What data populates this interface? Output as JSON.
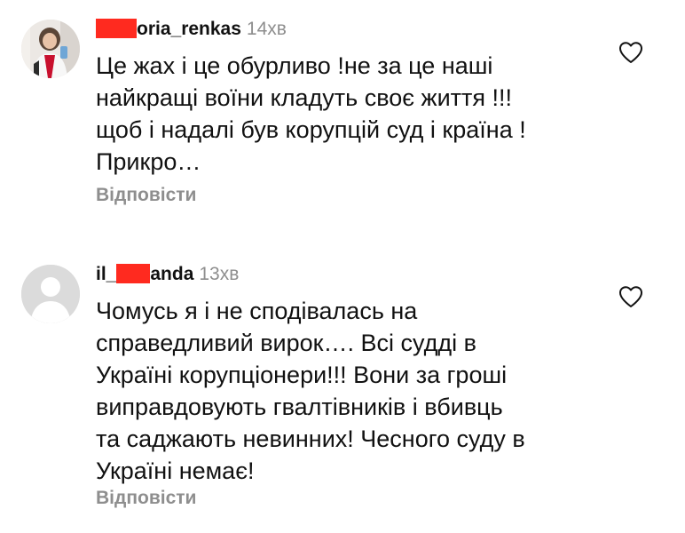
{
  "comments": [
    {
      "username": "oria_renkas",
      "time": "14хв",
      "lines": [
        "Це жах і це обурливо !не за це наші",
        "найкращі воїни кладуть своє життя !!!",
        "щоб і надалі був корупцій суд і країна !",
        "Прикро…"
      ],
      "reply_label": "Відповісти",
      "avatar_icon": "user-photo-avatar",
      "like_icon": "heart-outline-icon"
    },
    {
      "username_prefix": "il_",
      "username_suffix": "anda",
      "time": "13хв",
      "lines": [
        "Чомусь я і не сподівалась на",
        "справедливий вирок…. Всі судді в",
        "Україні корупціонери!!! Вони за гроші",
        "виправдовують гвалтівників і вбивць",
        "та саджають невинних! Чесного суду в",
        "Україні немає!"
      ],
      "reply_label": "Відповісти",
      "avatar_icon": "default-avatar-icon",
      "like_icon": "heart-outline-icon"
    }
  ],
  "colors": {
    "text": "#111111",
    "secondary": "#8e8e8e",
    "redaction": "#ff2a1f",
    "default_avatar_bg": "#dbdbdb"
  }
}
